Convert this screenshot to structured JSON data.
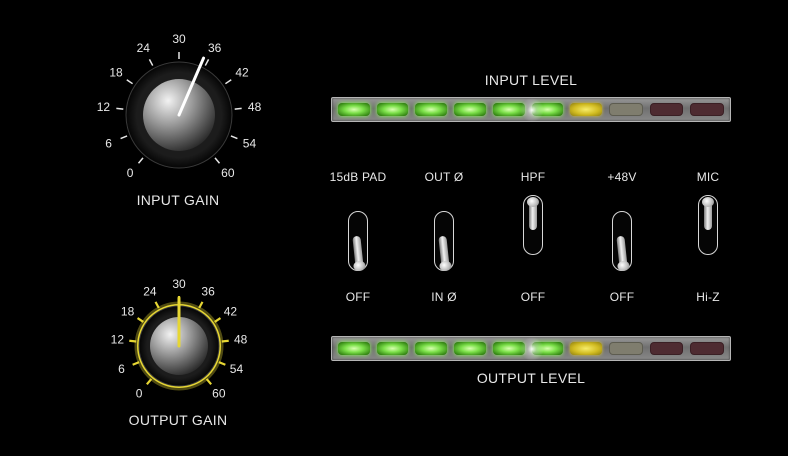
{
  "input_gain": {
    "caption": "INPUT GAIN",
    "scale_labels": [
      "0",
      "6",
      "12",
      "18",
      "24",
      "30",
      "36",
      "42",
      "48",
      "54",
      "60"
    ],
    "value": 35,
    "highlighted": false
  },
  "output_gain": {
    "caption": "OUTPUT GAIN",
    "scale_labels": [
      "0",
      "6",
      "12",
      "18",
      "24",
      "30",
      "36",
      "42",
      "48",
      "54",
      "60"
    ],
    "value": 30,
    "highlighted": true,
    "highlight_color": "#e6d633"
  },
  "input_meter": {
    "label": "INPUT LEVEL",
    "segments": [
      "green",
      "green",
      "green",
      "green",
      "green",
      "green",
      "yellow",
      "off-gray",
      "off-red",
      "off-red"
    ]
  },
  "output_meter": {
    "label": "OUTPUT LEVEL",
    "segments": [
      "green",
      "green",
      "green",
      "green",
      "green",
      "green",
      "yellow",
      "off-gray",
      "off-red",
      "off-red"
    ]
  },
  "switches": [
    {
      "top_label": "15dB PAD",
      "bottom_label": "OFF",
      "position": "down"
    },
    {
      "top_label": "OUT Ø",
      "bottom_label": "IN Ø",
      "position": "down"
    },
    {
      "top_label": "HPF",
      "bottom_label": "OFF",
      "position": "up"
    },
    {
      "top_label": "+48V",
      "bottom_label": "OFF",
      "position": "down"
    },
    {
      "top_label": "MIC",
      "bottom_label": "Hi-Z",
      "position": "up"
    }
  ],
  "colors": {
    "background": "#000000",
    "meter_green": "#7ce04a",
    "meter_yellow": "#d1bb21",
    "knob_highlight": "#e6d633"
  }
}
